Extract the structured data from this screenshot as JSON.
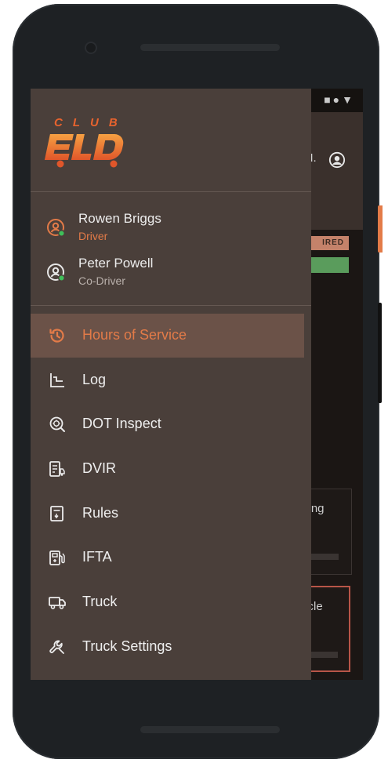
{
  "status_bar": {
    "icons": "■●▼"
  },
  "app_bar": {
    "partial_text": "M."
  },
  "background_badges": {
    "red_text": "IRED"
  },
  "background_cards": [
    {
      "partial_text": "ving"
    },
    {
      "partial_text": "ycle"
    }
  ],
  "drawer": {
    "logo": {
      "club_text": "CLUB",
      "brand_text": "ELD"
    },
    "users": [
      {
        "name": "Rowen Briggs",
        "role": "Driver"
      },
      {
        "name": "Peter Powell",
        "role": "Co-Driver"
      }
    ],
    "menu": [
      {
        "label": "Hours of Service",
        "icon": "clock-history-icon",
        "active": true
      },
      {
        "label": "Log",
        "icon": "log-chart-icon"
      },
      {
        "label": "DOT Inspect",
        "icon": "inspect-search-icon"
      },
      {
        "label": "DVIR",
        "icon": "clipboard-truck-icon"
      },
      {
        "label": "Rules",
        "icon": "rules-document-icon"
      },
      {
        "label": "IFTA",
        "icon": "fuel-pump-icon"
      },
      {
        "label": "Truck",
        "icon": "truck-icon"
      },
      {
        "label": "Truck Settings",
        "icon": "wrench-icon"
      }
    ]
  },
  "colors": {
    "accent": "#e37b48",
    "drawer_bg": "#4a3f3a",
    "active_bg": "#6b5248",
    "online_green": "#3fbf5a"
  }
}
